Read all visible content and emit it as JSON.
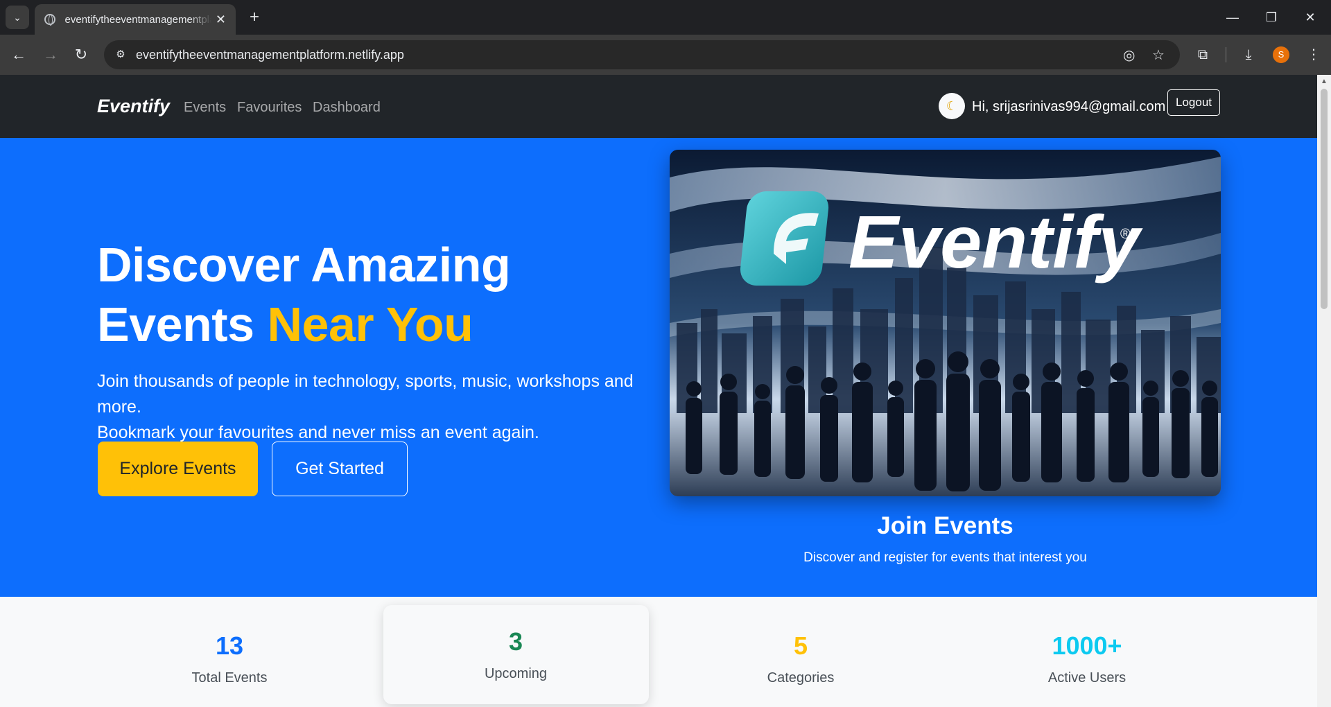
{
  "browser": {
    "tab_title": "eventifytheeventmanagementplatform.netlify.app",
    "url": "eventifytheeventmanagementplatform.netlify.app",
    "profile_initial": "S"
  },
  "nav": {
    "brand": "Eventify",
    "links": [
      "Events",
      "Favourites",
      "Dashboard"
    ],
    "greeting": "Hi, srijasrinivas994@gmail.com",
    "logout_label": "Logout"
  },
  "hero": {
    "title_line1": "Discover Amazing",
    "title_line2_plain": "Events ",
    "title_line2_accent": "Near You",
    "lead_line1": "Join thousands of people in technology, sports, music, workshops and more.",
    "lead_line2": "Bookmark your favourites and never miss an event again.",
    "explore_label": "Explore Events",
    "start_label": "Get Started",
    "image_logo_text": "Eventify",
    "image_logo_mark": "®",
    "caption_title": "Join Events",
    "caption_sub": "Discover and register for events that interest you"
  },
  "stats": [
    {
      "value": "13",
      "label": "Total Events",
      "color": "#0d6efd"
    },
    {
      "value": "3",
      "label": "Upcoming",
      "color": "#198754"
    },
    {
      "value": "5",
      "label": "Categories",
      "color": "#ffc107"
    },
    {
      "value": "1000+",
      "label": "Active Users",
      "color": "#0dcaf0"
    }
  ],
  "colors": {
    "primary": "#0d6efd",
    "accent": "#ffc107",
    "navbar": "#212529"
  }
}
